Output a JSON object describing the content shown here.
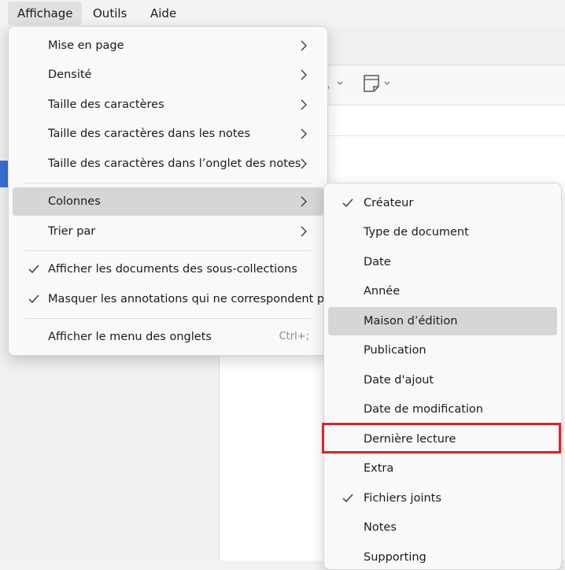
{
  "menubar": {
    "items": [
      {
        "label": "Affichage"
      },
      {
        "label": "Outils"
      },
      {
        "label": "Aide"
      }
    ]
  },
  "view_menu": {
    "items": [
      {
        "label": "Mise en page"
      },
      {
        "label": "Densité"
      },
      {
        "label": "Taille des caractères"
      },
      {
        "label": "Taille des caractères dans les notes"
      },
      {
        "label": "Taille des caractères dans l’onglet des notes"
      },
      {
        "label": "Colonnes"
      },
      {
        "label": "Trier par"
      },
      {
        "label": "Afficher les documents des sous-collections",
        "checked": true
      },
      {
        "label": "Masquer les annotations qui ne correspondent pas",
        "checked": true
      },
      {
        "label": "Afficher le menu des onglets",
        "shortcut": "Ctrl+;"
      }
    ]
  },
  "columns_menu": {
    "items": [
      {
        "label": "Créateur",
        "checked": true
      },
      {
        "label": "Type de document"
      },
      {
        "label": "Date"
      },
      {
        "label": "Année"
      },
      {
        "label": "Maison d’édition"
      },
      {
        "label": "Publication"
      },
      {
        "label": "Date d'ajout"
      },
      {
        "label": "Date de modification"
      },
      {
        "label": "Dernière lecture"
      },
      {
        "label": "Extra"
      },
      {
        "label": "Fichiers joints",
        "checked": true
      },
      {
        "label": "Notes"
      },
      {
        "label": "Supporting"
      }
    ]
  },
  "colors": {
    "highlight": "#d6d6d6",
    "annotation_box": "#e0202a",
    "selection_accent": "#3a6fd8"
  }
}
